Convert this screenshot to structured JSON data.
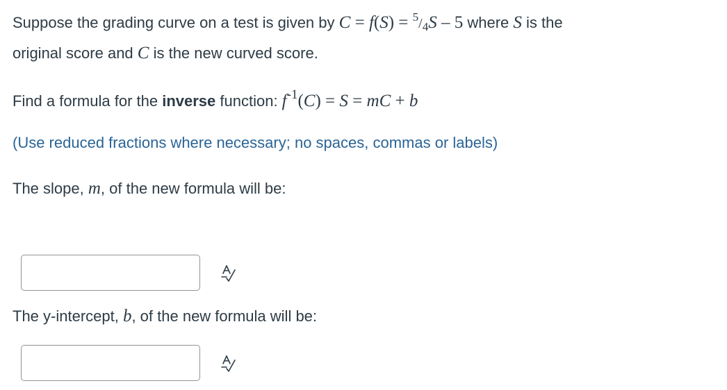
{
  "problem": {
    "line1_prefix": "Suppose the grading curve on a test is given by ",
    "C": "C",
    "eq": " = ",
    "f": "f",
    "S": "S",
    "frac_num": "5",
    "frac_slash": "/",
    "frac_den": "4",
    "minus_five": " – 5",
    "where_text": " where ",
    "is_the": " is the",
    "line2_prefix": "original score and ",
    "line2_suffix": " is the new curved score."
  },
  "question": {
    "prefix": "Find a formula for the ",
    "bold": "inverse",
    "suffix": " function: ",
    "f": "f",
    "inv_exp": "-1",
    "rhs_m": "m",
    "plus": " + ",
    "b": "b"
  },
  "hint": "(Use reduced fractions where necessary; no spaces, commas or labels)",
  "slope_prompt": {
    "prefix": "The slope, ",
    "var": "m",
    "suffix": ", of the new formula will be:"
  },
  "intercept_prompt": {
    "prefix": "The y-intercept, ",
    "var": "b",
    "suffix": ", of the new formula will be:"
  },
  "answers": {
    "slope_value": "",
    "intercept_value": ""
  },
  "icons": {
    "preview": "answer-preview-icon"
  }
}
